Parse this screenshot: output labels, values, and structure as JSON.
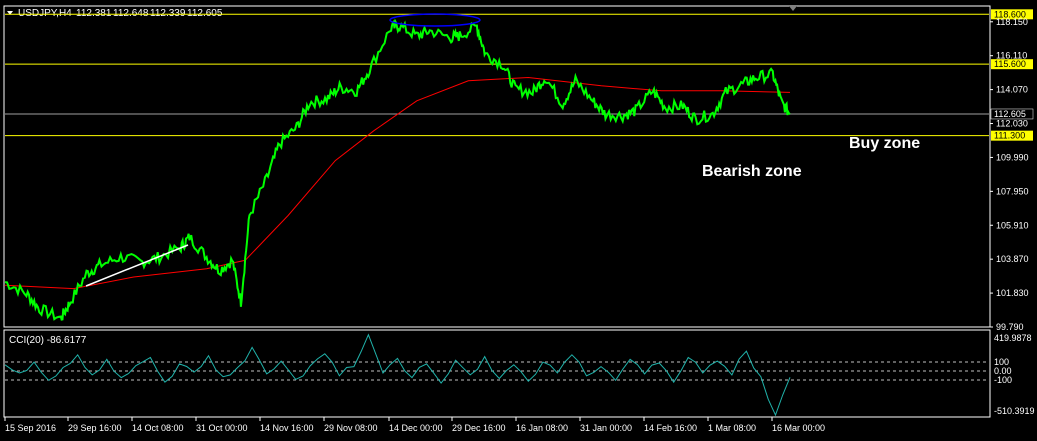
{
  "header": {
    "symbol": "USDJPY,H4",
    "open": "112.381",
    "high": "112.648",
    "low": "112.339",
    "close": "112.605"
  },
  "colors": {
    "background": "#000000",
    "price": "#00ff00",
    "ma": "#ff0000",
    "level": "#ffff00",
    "cci": "#20b2aa",
    "ellipse": "#0000ff",
    "trend": "#ffffff",
    "frame": "#ffffff"
  },
  "price_axis": {
    "labels": [
      "118.150",
      "116.110",
      "114.070",
      "112.030",
      "109.990",
      "107.950",
      "105.910",
      "103.870",
      "101.830",
      "99.790"
    ],
    "range": [
      99.79,
      119.1
    ]
  },
  "levels": [
    {
      "price": 118.6,
      "label": "118.600"
    },
    {
      "price": 115.6,
      "label": "115.600"
    },
    {
      "price": 111.3,
      "label": "111.300"
    }
  ],
  "current_price": {
    "price": 112.605,
    "label": "112.605"
  },
  "annotations": {
    "buy_zone": "Buy zone",
    "bearish_zone": "Bearish zone"
  },
  "cci": {
    "title": "CCI(20) -86.6177",
    "levels": [
      "419.9878",
      "100",
      "0.00",
      "-100",
      "-510.3919"
    ],
    "range": [
      -510.39,
      419.99
    ]
  },
  "time_axis": {
    "labels": [
      "15 Sep 2016",
      "29 Sep 16:00",
      "14 Oct 08:00",
      "31 Oct 00:00",
      "14 Nov 16:00",
      "29 Nov 08:00",
      "14 Dec 00:00",
      "29 Dec 16:00",
      "16 Jan 08:00",
      "31 Jan 00:00",
      "14 Feb 16:00",
      "1 Mar 08:00",
      "16 Mar 00:00"
    ]
  },
  "chart_data": {
    "type": "line",
    "title": "USDJPY,H4",
    "series": [
      {
        "name": "USDJPY",
        "x": [
          "2016-09-15",
          "2016-09-20",
          "2016-09-23",
          "2016-09-28",
          "2016-09-30",
          "2016-10-04",
          "2016-10-07",
          "2016-10-12",
          "2016-10-17",
          "2016-10-21",
          "2016-10-26",
          "2016-10-28",
          "2016-11-01",
          "2016-11-04",
          "2016-11-07",
          "2016-11-09",
          "2016-11-11",
          "2016-11-15",
          "2016-11-18",
          "2016-11-22",
          "2016-11-25",
          "2016-11-29",
          "2016-12-02",
          "2016-12-06",
          "2016-12-09",
          "2016-12-14",
          "2016-12-16",
          "2016-12-20",
          "2016-12-23",
          "2016-12-28",
          "2016-12-30",
          "2017-01-03",
          "2017-01-05",
          "2017-01-09",
          "2017-01-12",
          "2017-01-16",
          "2017-01-19",
          "2017-01-23",
          "2017-01-26",
          "2017-01-30",
          "2017-02-02",
          "2017-02-06",
          "2017-02-09",
          "2017-02-13",
          "2017-02-16",
          "2017-02-20",
          "2017-02-23",
          "2017-02-27",
          "2017-03-02",
          "2017-03-06",
          "2017-03-09",
          "2017-03-13",
          "2017-03-15",
          "2017-03-17"
        ],
        "values": [
          102.5,
          101.8,
          100.9,
          100.3,
          101.2,
          103.0,
          103.5,
          104.0,
          103.7,
          104.0,
          104.6,
          105.2,
          104.0,
          103.2,
          103.8,
          101.3,
          106.5,
          108.7,
          110.8,
          111.8,
          113.3,
          113.5,
          114.2,
          114.0,
          115.3,
          117.8,
          117.9,
          117.3,
          117.6,
          117.2,
          117.3,
          117.9,
          116.2,
          115.6,
          114.1,
          113.9,
          114.8,
          113.2,
          114.6,
          113.4,
          112.6,
          112.5,
          112.8,
          114.0,
          113.0,
          113.1,
          112.3,
          112.6,
          113.9,
          114.4,
          114.8,
          115.0,
          113.3,
          112.6
        ]
      },
      {
        "name": "MA",
        "x": [
          "2016-09-15",
          "2016-10-01",
          "2016-10-15",
          "2016-11-01",
          "2016-11-10",
          "2016-11-20",
          "2016-12-01",
          "2016-12-10",
          "2016-12-20",
          "2017-01-01",
          "2017-01-15",
          "2017-02-01",
          "2017-02-15",
          "2017-03-01",
          "2017-03-17"
        ],
        "values": [
          102.3,
          102.1,
          102.8,
          103.3,
          103.8,
          106.5,
          109.8,
          111.6,
          113.4,
          114.6,
          114.8,
          114.3,
          114.0,
          114.0,
          113.9
        ]
      }
    ],
    "levels": [
      118.6,
      115.6,
      111.3
    ],
    "ylim": [
      99.79,
      119.1
    ],
    "indicator": {
      "name": "CCI(20)",
      "last": -86.6177,
      "ylim": [
        -510.39,
        419.99
      ],
      "reference_lines": [
        100,
        0,
        -100
      ],
      "values": [
        50,
        -40,
        80,
        -120,
        20,
        160,
        -60,
        110,
        -90,
        40,
        130,
        -140,
        60,
        -30,
        150,
        -80,
        20,
        240,
        -50,
        90,
        -110,
        40,
        170,
        -70,
        30,
        380,
        -40,
        120,
        -90,
        60,
        -150,
        100,
        -60,
        140,
        -100,
        50,
        -130,
        80,
        -40,
        160,
        -70,
        30,
        -120,
        110,
        -50,
        70,
        -140,
        130,
        -40,
        90,
        -60,
        200,
        -80,
        -500,
        -86.6
      ]
    },
    "grid": false
  }
}
